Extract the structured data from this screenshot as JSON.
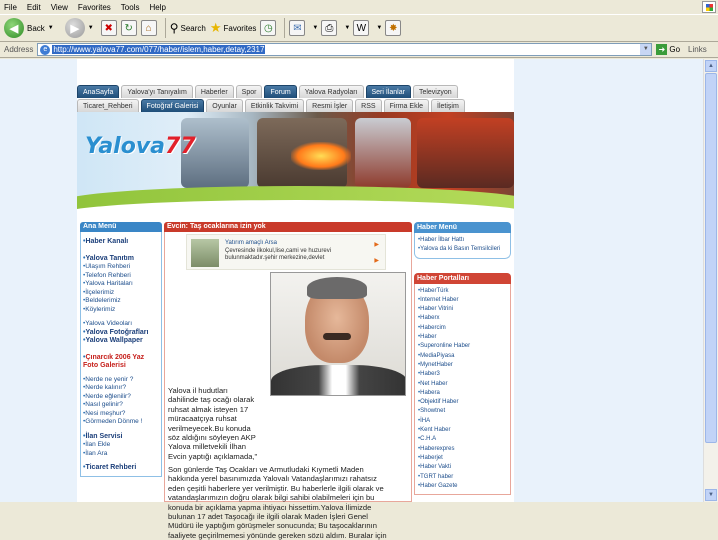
{
  "browser": {
    "menu": [
      "File",
      "Edit",
      "View",
      "Favorites",
      "Tools",
      "Help"
    ],
    "toolbar": {
      "back": "Back",
      "search": "Search",
      "favorites": "Favorites"
    },
    "address_label": "Address",
    "url": "http://www.yalova77.com/077/haber/islem,haber,detay,2317",
    "go": "Go",
    "links": "Links"
  },
  "nav": {
    "row1": [
      "AnaSayfa",
      "Yalova'yı Tanıyalım",
      "Haberler",
      "Spor",
      "Forum",
      "Yalova Radyoları",
      "Seri İlanlar",
      "Televizyon"
    ],
    "row1_dark": [
      true,
      false,
      false,
      false,
      true,
      false,
      true,
      false
    ],
    "row2": [
      "Ticaret_Rehberi",
      "Fotoğraf Galerisi",
      "Oyunlar",
      "Etkinlik Takvimi",
      "Resmi İşler",
      "RSS",
      "Firma Ekle",
      "İletişim"
    ],
    "row2_dark": [
      false,
      true,
      false,
      false,
      false,
      false,
      false,
      false
    ]
  },
  "logo": {
    "text": "Yalova",
    "num": "77"
  },
  "left": {
    "menu_title": "Ana Menü",
    "haber_kanali": "Haber Kanalı",
    "yalova_tanitim": "Yalova Tanıtım",
    "tanitim_items": [
      "Ulaşım Rehberi",
      "Telefon Rehberi",
      "Yalova Haritaları",
      "İlçelerimiz",
      "Beldelerimiz",
      "Köylerimiz"
    ],
    "videolar": "Yalova Videoları",
    "fotograflari": "Yalova Fotoğrafları",
    "wallpaper": "Yalova Wallpaper",
    "cinarcik": "Çınarcık 2006 Yaz Foto Galerisi",
    "nerede_items": [
      "Nerde ne yenir ?",
      "Nerde kalınır?",
      "Nerde eğlenilir?",
      "Nasıl gelinir?",
      "Nesi meşhur?",
      "Görmeden Dönme !"
    ],
    "ilan_servisi": "İlan Servisi",
    "ilan_items": [
      "İlan Ekle",
      "İlan Ara"
    ],
    "ticaret": "Ticaret Rehberi"
  },
  "center": {
    "header": "Evcin: Taş ocaklarına izin yok",
    "ad_title": "Yatırım amaçlı Arsa",
    "ad_text": "Çevresinde ilkokul,lise,cami ve huzurevi bulunmaktadır.şehir merkezine,devlet",
    "article_lines_wrapped": [
      "Yalova il hudutları",
      "dahilinde taş ocağı olarak",
      "ruhsat almak isteyen 17",
      "müracaatçıya ruhsat",
      "verilmeyecek.Bu konuda",
      "söz aldığını söyleyen AKP",
      "Yalova milletvekili İlhan",
      "Evcin yaptığı açıklamada,\""
    ],
    "article_lines_full": [
      "Son günlerde Taş Ocakları ve Armutludaki Kıymetli Maden",
      "hakkında yerel basınımızda Yalovalı Vatandaşlarımızı rahatsız",
      "eden çeşitli haberlere yer verilmiştir. Bu haberlerle ilgili olarak ve",
      "vatandaşlarımızın doğru olarak bilgi sahibi olabilmeleri için bu",
      "konuda bir açıklama yapma ihtiyacı hissettim.Yalova İlimizde",
      "bulunan 17 adet Taşocağı ile ilgili olarak Maden İşleri Genel",
      "Müdürü ile yaptığım görüşmeler sonucunda; Bu taşocaklarının",
      "faaliyete geçirilmemesi yönünde gereken sözü aldım. Buralar için"
    ]
  },
  "right": {
    "haber_menu_title": "Haber Menü",
    "haber_menu_items": [
      "Haber İlbar Hattı",
      "Yalova da ki Basın Temsilcileri"
    ],
    "portallar_title": "Haber Portalları",
    "portallar_items": [
      "HaberTürk",
      "Internet Haber",
      "Haber Vitrini",
      "Haberx",
      "Habercim",
      "Haber",
      "Superonline Haber",
      "MediaPiyasa",
      "MynetHaber",
      "Haber3",
      "Net Haber",
      "Habera",
      "Objektif Haber",
      "Showtnet",
      "İHA",
      "Kent Haber",
      "C.H.A",
      "Haberexpres",
      "Haberjet",
      "Haber Vakti",
      "TGRT haber",
      "Haber Gazete"
    ]
  }
}
